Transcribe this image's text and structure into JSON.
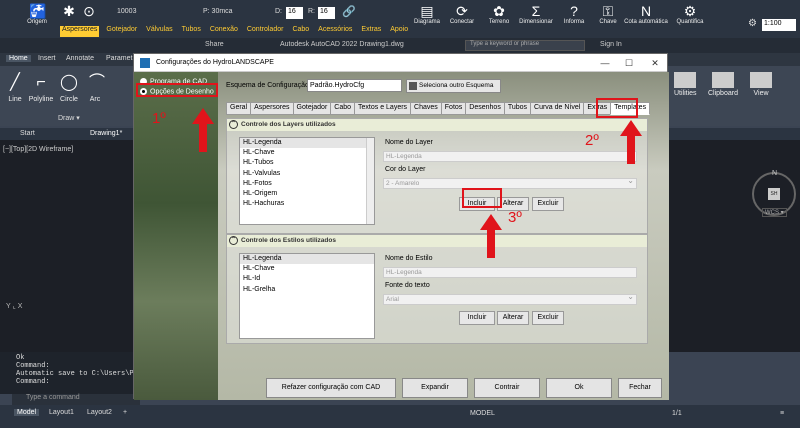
{
  "topbar": {
    "tools": [
      {
        "label": "Origem",
        "icon": "faucet-icon"
      },
      {
        "label": "",
        "icon": "sprinkler-icon"
      },
      {
        "label": "",
        "icon": "binoculars-icon"
      }
    ],
    "code_value": "10003",
    "pressure_label": "P: 30mca",
    "d_label": "D:",
    "d_value": "16",
    "r_label": "R:",
    "r_value": "16",
    "right_tools": [
      "Diagrama",
      "Conectar",
      "Terreno",
      "Dimensionar",
      "Informa",
      "Chave",
      "Cota automática",
      "Quantifica"
    ],
    "scale_value": "1:100"
  },
  "plugin_tabs": [
    "Aspersores",
    "Gotejador",
    "Válvulas",
    "Tubos",
    "Conexão",
    "Controlador",
    "Cabo",
    "Acessórios",
    "Extras",
    "Apoio"
  ],
  "plugin_active": "Aspersores",
  "cad": {
    "title": "Autodesk AutoCAD 2022    Drawing1.dwg",
    "share": "Share",
    "search_placeholder": "Type a keyword or phrase",
    "signin": "Sign In"
  },
  "ribbon_tabs": [
    "Home",
    "Insert",
    "Annotate",
    "Parametric"
  ],
  "ribbon_tools": [
    "Line",
    "Polyline",
    "Circle",
    "Arc"
  ],
  "draw_panel": "Draw ▾",
  "right_ribbon": [
    "Utilities",
    "Clipboard",
    "View"
  ],
  "doc_tabs": [
    "Start",
    "Drawing1*"
  ],
  "view_label": "[−][Top][2D Wireframe]",
  "compass": {
    "n": "N",
    "center": "SH",
    "wcs": "WCS ▾"
  },
  "cmd_log": "Ok\nCommand:\nAutomatic save to C:\\Users\\Pi\nCommand:",
  "cmd_placeholder": "Type a command",
  "status": {
    "tabs": [
      "Model",
      "Layout1",
      "Layout2",
      "+"
    ],
    "model": "MODEL",
    "scale": "1/1"
  },
  "dialog": {
    "title": "Configurações do HydroLANDSCAPE",
    "radio_options": [
      "Programa de CAD",
      "Opções de Desenho"
    ],
    "radio_selected": 1,
    "esquema_label": "Esquema de Configuração:",
    "esquema_value": "Padrão.HydroCfg",
    "esquema_button": "Seleciona outro Esquema",
    "tabs": [
      "Geral",
      "Aspersores",
      "Gotejador",
      "Cabo",
      "Textos e Layers",
      "Chaves",
      "Fotos",
      "Desenhos",
      "Tubos",
      "Curva de Nível",
      "Extras",
      "Templates"
    ],
    "tab_selected": "Templates",
    "layers_group": {
      "header": "Controle dos Layers utilizados",
      "items": [
        "HL-Legenda",
        "HL-Chave",
        "HL-Tubos",
        "HL-Valvulas",
        "HL-Fotos",
        "HL-Origem",
        "HL-Hachuras"
      ],
      "name_label": "Nome do Layer",
      "name_value": "HL-Legenda",
      "color_label": "Cor do Layer",
      "color_value": "2 - Amarelo",
      "buttons": [
        "Incluir",
        "Alterar",
        "Excluir"
      ]
    },
    "styles_group": {
      "header": "Controle dos Estilos utilizados",
      "items": [
        "HL-Legenda",
        "HL-Chave",
        "HL-Id",
        "HL-Grelha"
      ],
      "name_label": "Nome do Estilo",
      "name_value": "HL-Legenda",
      "font_label": "Fonte do texto",
      "font_value": "Arial",
      "buttons": [
        "Incluir",
        "Alterar",
        "Excluir"
      ]
    },
    "footer_buttons": [
      "Refazer configuração com CAD",
      "Expandir",
      "Contrair",
      "Ok",
      "Fechar"
    ]
  },
  "annotations": [
    "1º",
    "2º",
    "3º"
  ],
  "colors": {
    "annotation": "#e0141b",
    "plugin_accent": "#ffcc33"
  }
}
